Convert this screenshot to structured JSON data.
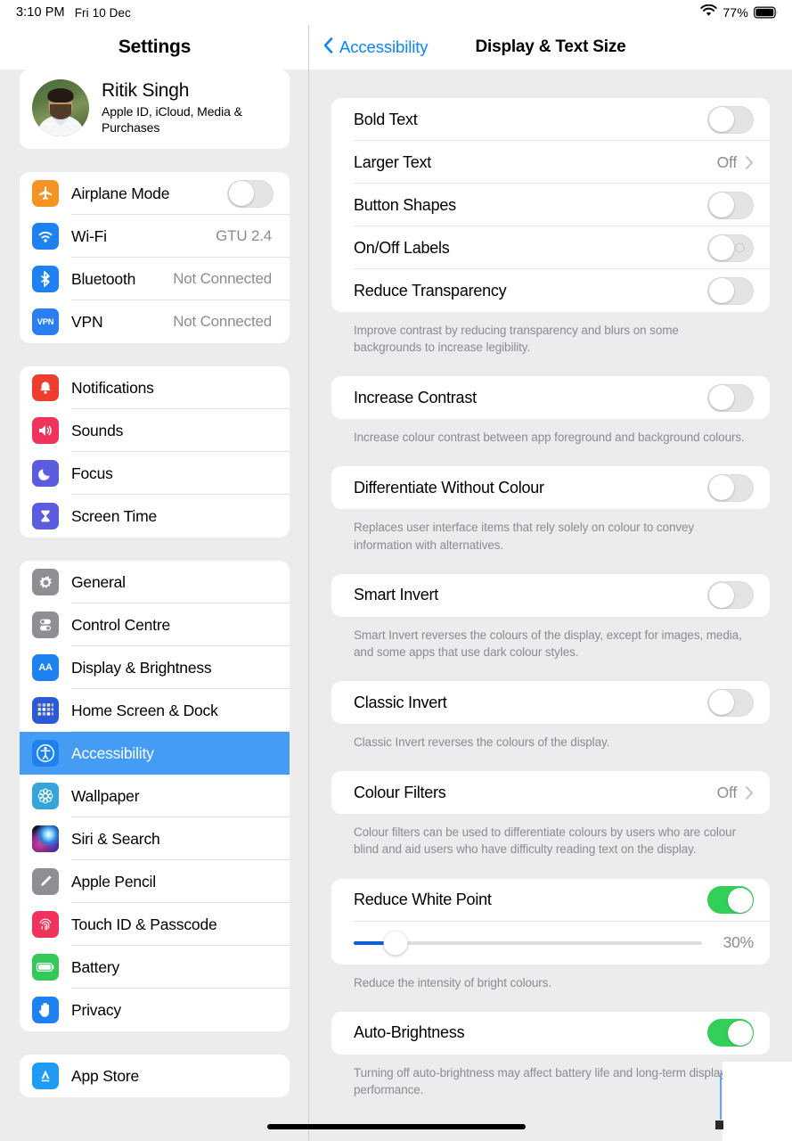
{
  "statusbar": {
    "time": "3:10 PM",
    "date": "Fri 10 Dec",
    "battery_percent": "77%",
    "wifi_icon": "wifi-icon",
    "battery_icon": "battery-icon"
  },
  "sidebar": {
    "title": "Settings",
    "profile": {
      "name": "Ritik Singh",
      "subtitle": "Apple ID, iCloud, Media & Purchases"
    },
    "groups": [
      {
        "items": [
          {
            "label": "Airplane Mode",
            "icon": "airplane-icon",
            "color": "#f59323",
            "control": "toggle",
            "on": false
          },
          {
            "label": "Wi-Fi",
            "icon": "wifi-icon",
            "color": "#1d82f0",
            "value": "GTU 2.4"
          },
          {
            "label": "Bluetooth",
            "icon": "bluetooth-icon",
            "color": "#1d82f0",
            "value": "Not Connected"
          },
          {
            "label": "VPN",
            "icon": "vpn-icon",
            "color": "#2a7ff0",
            "value": "Not Connected"
          }
        ]
      },
      {
        "items": [
          {
            "label": "Notifications",
            "icon": "notifications-bell-icon",
            "color": "#f03c2e"
          },
          {
            "label": "Sounds",
            "icon": "sounds-speaker-icon",
            "color": "#f0335b"
          },
          {
            "label": "Focus",
            "icon": "focus-moon-icon",
            "color": "#5c5ce0"
          },
          {
            "label": "Screen Time",
            "icon": "screen-time-hourglass-icon",
            "color": "#5c5ce0"
          }
        ]
      },
      {
        "items": [
          {
            "label": "General",
            "icon": "gear-icon",
            "color": "#8e8e93"
          },
          {
            "label": "Control Centre",
            "icon": "control-centre-icon",
            "color": "#8e8e93"
          },
          {
            "label": "Display & Brightness",
            "icon": "display-brightness-aa-icon",
            "color": "#1d82f0"
          },
          {
            "label": "Home Screen & Dock",
            "icon": "home-screen-grid-icon",
            "color": "#2a5bd7"
          },
          {
            "label": "Accessibility",
            "icon": "accessibility-person-icon",
            "color": "#1d82f0",
            "selected": true
          },
          {
            "label": "Wallpaper",
            "icon": "wallpaper-flower-icon",
            "color": "#35a4d8"
          },
          {
            "label": "Siri & Search",
            "icon": "siri-orb-icon",
            "color": "#2c2c38"
          },
          {
            "label": "Apple Pencil",
            "icon": "apple-pencil-icon",
            "color": "#8e8e93"
          },
          {
            "label": "Touch ID & Passcode",
            "icon": "touch-id-fingerprint-icon",
            "color": "#f0335b"
          },
          {
            "label": "Battery",
            "icon": "battery-icon",
            "color": "#34c759"
          },
          {
            "label": "Privacy",
            "icon": "privacy-hand-icon",
            "color": "#1d82f0"
          }
        ]
      },
      {
        "items": [
          {
            "label": "App Store",
            "icon": "app-store-icon",
            "color": "#1d9bf5"
          }
        ]
      }
    ]
  },
  "detail": {
    "back_label": "Accessibility",
    "back_icon": "chevron-left-icon",
    "title": "Display & Text Size",
    "sections": [
      {
        "rows": [
          {
            "label": "Bold Text",
            "control": "toggle",
            "on": false
          },
          {
            "label": "Larger Text",
            "control": "disclosure",
            "value": "Off",
            "icon": "chevron-right-icon"
          },
          {
            "label": "Button Shapes",
            "control": "toggle",
            "on": false
          },
          {
            "label": "On/Off Labels",
            "control": "toggle",
            "on": false,
            "off_label_mark": true
          },
          {
            "label": "Reduce Transparency",
            "control": "toggle",
            "on": false
          }
        ],
        "note": "Improve contrast by reducing transparency and blurs on some backgrounds to increase legibility."
      },
      {
        "rows": [
          {
            "label": "Increase Contrast",
            "control": "toggle",
            "on": false
          }
        ],
        "note": "Increase colour contrast between app foreground and background colours."
      },
      {
        "rows": [
          {
            "label": "Differentiate Without Colour",
            "control": "toggle",
            "on": false
          }
        ],
        "note": "Replaces user interface items that rely solely on colour to convey information with alternatives."
      },
      {
        "rows": [
          {
            "label": "Smart Invert",
            "control": "toggle",
            "on": false
          }
        ],
        "note": "Smart Invert reverses the colours of the display, except for images, media, and some apps that use dark colour styles."
      },
      {
        "rows": [
          {
            "label": "Classic Invert",
            "control": "toggle",
            "on": false
          }
        ],
        "note": "Classic Invert reverses the colours of the display."
      },
      {
        "rows": [
          {
            "label": "Colour Filters",
            "control": "disclosure",
            "value": "Off",
            "icon": "chevron-right-icon"
          }
        ],
        "note": "Colour filters can be used to differentiate colours by users who are colour blind and aid users who have difficulty reading text on the display."
      },
      {
        "rows": [
          {
            "label": "Reduce White Point",
            "control": "toggle",
            "on": true
          },
          {
            "control": "slider",
            "value": "30%",
            "percent": 30
          }
        ],
        "note": "Reduce the intensity of bright colours."
      },
      {
        "rows": [
          {
            "label": "Auto-Brightness",
            "control": "toggle",
            "on": true
          }
        ],
        "note": "Turning off auto-brightness may affect battery life and long-term display performance."
      }
    ]
  },
  "colors": {
    "accent_blue": "#0a84ff",
    "selected_row": "#449cf5",
    "toggle_on_green": "#32d058",
    "slider_fill": "#0a5fd6",
    "group_bg": "#ffffff",
    "page_bg": "#ececef",
    "secondary_text": "#8b8b90"
  }
}
